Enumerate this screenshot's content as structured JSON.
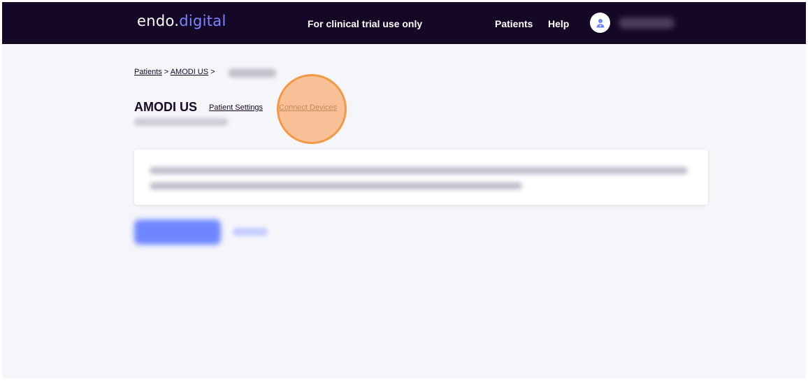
{
  "header": {
    "logo_part1": "endo.",
    "logo_part2": "digital",
    "notice": "For clinical trial use only",
    "nav_patients": "Patients",
    "nav_help": "Help"
  },
  "breadcrumb": {
    "patients": "Patients",
    "sep1": " > ",
    "patient": "AMODI US",
    "sep2": " >"
  },
  "patient": {
    "name": "AMODI US",
    "settings_link": "Patient Settings",
    "devices_link": "Connect Devices"
  },
  "colors": {
    "header_bg": "#150726",
    "accent": "#7e86ff",
    "page_bg": "#f5f5fa",
    "highlight": "#f19a45"
  },
  "icons": {
    "avatar": "user-avatar-icon"
  }
}
